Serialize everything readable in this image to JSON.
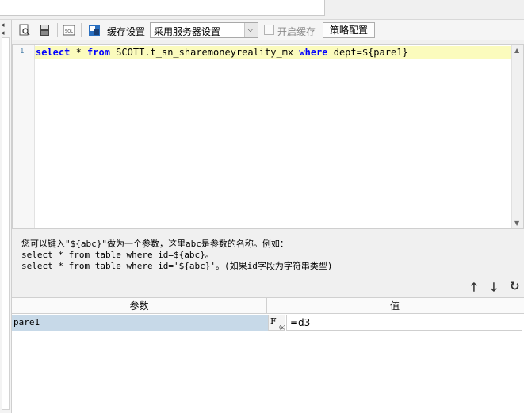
{
  "name_field": {
    "value": ""
  },
  "toolbar": {
    "cache_settings_label": "缓存设置",
    "cache_mode_value": "采用服务器设置",
    "enable_cache_label": "开启缓存",
    "enable_cache_checked": false,
    "policy_button_label": "策略配置"
  },
  "editor": {
    "line_number": "1",
    "sql": {
      "kw_select": "select",
      "star": " * ",
      "kw_from": "from",
      "table": " SCOTT.t_sn_sharemoneyreality_mx ",
      "kw_where": "where",
      "condition": " dept=${pare1}"
    }
  },
  "hint": {
    "line1": "您可以键入\"${abc}\"做为一个参数，这里abc是参数的名称。例如：",
    "line2": "select * from table where id=${abc}。",
    "line3": "select * from table where id='${abc}'。(如果id字段为字符串类型)"
  },
  "actions": {
    "up": "🡑",
    "down": "🡓",
    "refresh": "↻"
  },
  "params": {
    "header_name": "参数",
    "header_value": "值",
    "rows": [
      {
        "name": "pare1",
        "fx": "F",
        "fx_sub": "(x)",
        "value": "=d3"
      }
    ]
  }
}
